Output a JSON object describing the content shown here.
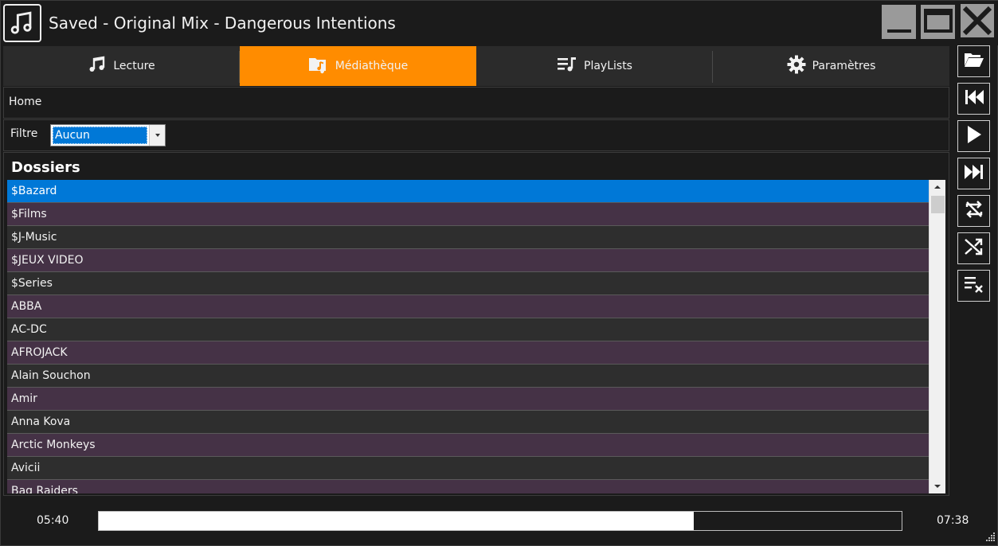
{
  "window": {
    "title": "Saved - Original Mix - Dangerous Intentions",
    "logo_icon": "music-note-icon",
    "controls": [
      "minimize-icon",
      "maximize-icon",
      "close-icon"
    ]
  },
  "tabs": [
    {
      "label": "Lecture",
      "icon": "music-note-icon",
      "active": false
    },
    {
      "label": "Médiathèque",
      "icon": "music-folder-icon",
      "active": true
    },
    {
      "label": "PlayLists",
      "icon": "playlist-icon",
      "active": false
    },
    {
      "label": "Paramètres",
      "icon": "gear-icon",
      "active": false
    }
  ],
  "breadcrumb": "Home",
  "filter": {
    "label": "Filtre",
    "selected": "Aucun"
  },
  "folders": {
    "title": "Dossiers",
    "items": [
      "$Bazard",
      "$Films",
      "$J-Music",
      "$JEUX VIDEO",
      "$Series",
      "ABBA",
      "AC-DC",
      "AFROJACK",
      "Alain Souchon",
      "Amir",
      "Anna Kova",
      "Arctic Monkeys",
      "Avicii",
      "Bag Raiders"
    ],
    "selected_index": 0
  },
  "side_controls": [
    "open-folder-icon",
    "previous-track-icon",
    "play-icon",
    "next-track-icon",
    "repeat-off-icon",
    "shuffle-icon",
    "clear-playlist-icon"
  ],
  "player": {
    "current_time": "05:40",
    "total_time": "07:38",
    "progress": 0.741
  },
  "colors": {
    "accent": "#ff8c00",
    "selection": "#0078d7",
    "row_alt": "#453246",
    "row": "#2e2e2e"
  }
}
